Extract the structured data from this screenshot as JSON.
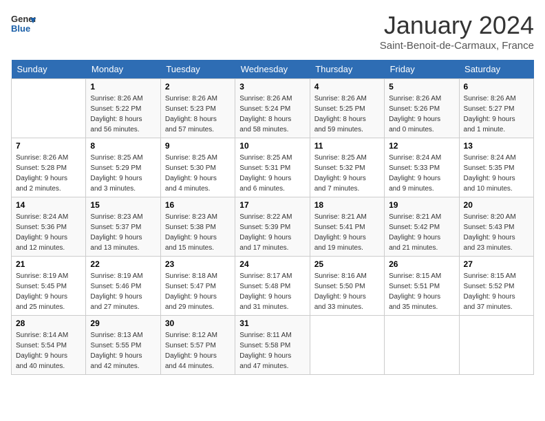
{
  "header": {
    "logo_line1": "General",
    "logo_line2": "Blue",
    "title": "January 2024",
    "subtitle": "Saint-Benoit-de-Carmaux, France"
  },
  "calendar": {
    "days_of_week": [
      "Sunday",
      "Monday",
      "Tuesday",
      "Wednesday",
      "Thursday",
      "Friday",
      "Saturday"
    ],
    "weeks": [
      [
        {
          "day": "",
          "info": ""
        },
        {
          "day": "1",
          "info": "Sunrise: 8:26 AM\nSunset: 5:22 PM\nDaylight: 8 hours\nand 56 minutes."
        },
        {
          "day": "2",
          "info": "Sunrise: 8:26 AM\nSunset: 5:23 PM\nDaylight: 8 hours\nand 57 minutes."
        },
        {
          "day": "3",
          "info": "Sunrise: 8:26 AM\nSunset: 5:24 PM\nDaylight: 8 hours\nand 58 minutes."
        },
        {
          "day": "4",
          "info": "Sunrise: 8:26 AM\nSunset: 5:25 PM\nDaylight: 8 hours\nand 59 minutes."
        },
        {
          "day": "5",
          "info": "Sunrise: 8:26 AM\nSunset: 5:26 PM\nDaylight: 9 hours\nand 0 minutes."
        },
        {
          "day": "6",
          "info": "Sunrise: 8:26 AM\nSunset: 5:27 PM\nDaylight: 9 hours\nand 1 minute."
        }
      ],
      [
        {
          "day": "7",
          "info": "Sunrise: 8:26 AM\nSunset: 5:28 PM\nDaylight: 9 hours\nand 2 minutes."
        },
        {
          "day": "8",
          "info": "Sunrise: 8:25 AM\nSunset: 5:29 PM\nDaylight: 9 hours\nand 3 minutes."
        },
        {
          "day": "9",
          "info": "Sunrise: 8:25 AM\nSunset: 5:30 PM\nDaylight: 9 hours\nand 4 minutes."
        },
        {
          "day": "10",
          "info": "Sunrise: 8:25 AM\nSunset: 5:31 PM\nDaylight: 9 hours\nand 6 minutes."
        },
        {
          "day": "11",
          "info": "Sunrise: 8:25 AM\nSunset: 5:32 PM\nDaylight: 9 hours\nand 7 minutes."
        },
        {
          "day": "12",
          "info": "Sunrise: 8:24 AM\nSunset: 5:33 PM\nDaylight: 9 hours\nand 9 minutes."
        },
        {
          "day": "13",
          "info": "Sunrise: 8:24 AM\nSunset: 5:35 PM\nDaylight: 9 hours\nand 10 minutes."
        }
      ],
      [
        {
          "day": "14",
          "info": "Sunrise: 8:24 AM\nSunset: 5:36 PM\nDaylight: 9 hours\nand 12 minutes."
        },
        {
          "day": "15",
          "info": "Sunrise: 8:23 AM\nSunset: 5:37 PM\nDaylight: 9 hours\nand 13 minutes."
        },
        {
          "day": "16",
          "info": "Sunrise: 8:23 AM\nSunset: 5:38 PM\nDaylight: 9 hours\nand 15 minutes."
        },
        {
          "day": "17",
          "info": "Sunrise: 8:22 AM\nSunset: 5:39 PM\nDaylight: 9 hours\nand 17 minutes."
        },
        {
          "day": "18",
          "info": "Sunrise: 8:21 AM\nSunset: 5:41 PM\nDaylight: 9 hours\nand 19 minutes."
        },
        {
          "day": "19",
          "info": "Sunrise: 8:21 AM\nSunset: 5:42 PM\nDaylight: 9 hours\nand 21 minutes."
        },
        {
          "day": "20",
          "info": "Sunrise: 8:20 AM\nSunset: 5:43 PM\nDaylight: 9 hours\nand 23 minutes."
        }
      ],
      [
        {
          "day": "21",
          "info": "Sunrise: 8:19 AM\nSunset: 5:45 PM\nDaylight: 9 hours\nand 25 minutes."
        },
        {
          "day": "22",
          "info": "Sunrise: 8:19 AM\nSunset: 5:46 PM\nDaylight: 9 hours\nand 27 minutes."
        },
        {
          "day": "23",
          "info": "Sunrise: 8:18 AM\nSunset: 5:47 PM\nDaylight: 9 hours\nand 29 minutes."
        },
        {
          "day": "24",
          "info": "Sunrise: 8:17 AM\nSunset: 5:48 PM\nDaylight: 9 hours\nand 31 minutes."
        },
        {
          "day": "25",
          "info": "Sunrise: 8:16 AM\nSunset: 5:50 PM\nDaylight: 9 hours\nand 33 minutes."
        },
        {
          "day": "26",
          "info": "Sunrise: 8:15 AM\nSunset: 5:51 PM\nDaylight: 9 hours\nand 35 minutes."
        },
        {
          "day": "27",
          "info": "Sunrise: 8:15 AM\nSunset: 5:52 PM\nDaylight: 9 hours\nand 37 minutes."
        }
      ],
      [
        {
          "day": "28",
          "info": "Sunrise: 8:14 AM\nSunset: 5:54 PM\nDaylight: 9 hours\nand 40 minutes."
        },
        {
          "day": "29",
          "info": "Sunrise: 8:13 AM\nSunset: 5:55 PM\nDaylight: 9 hours\nand 42 minutes."
        },
        {
          "day": "30",
          "info": "Sunrise: 8:12 AM\nSunset: 5:57 PM\nDaylight: 9 hours\nand 44 minutes."
        },
        {
          "day": "31",
          "info": "Sunrise: 8:11 AM\nSunset: 5:58 PM\nDaylight: 9 hours\nand 47 minutes."
        },
        {
          "day": "",
          "info": ""
        },
        {
          "day": "",
          "info": ""
        },
        {
          "day": "",
          "info": ""
        }
      ]
    ]
  }
}
